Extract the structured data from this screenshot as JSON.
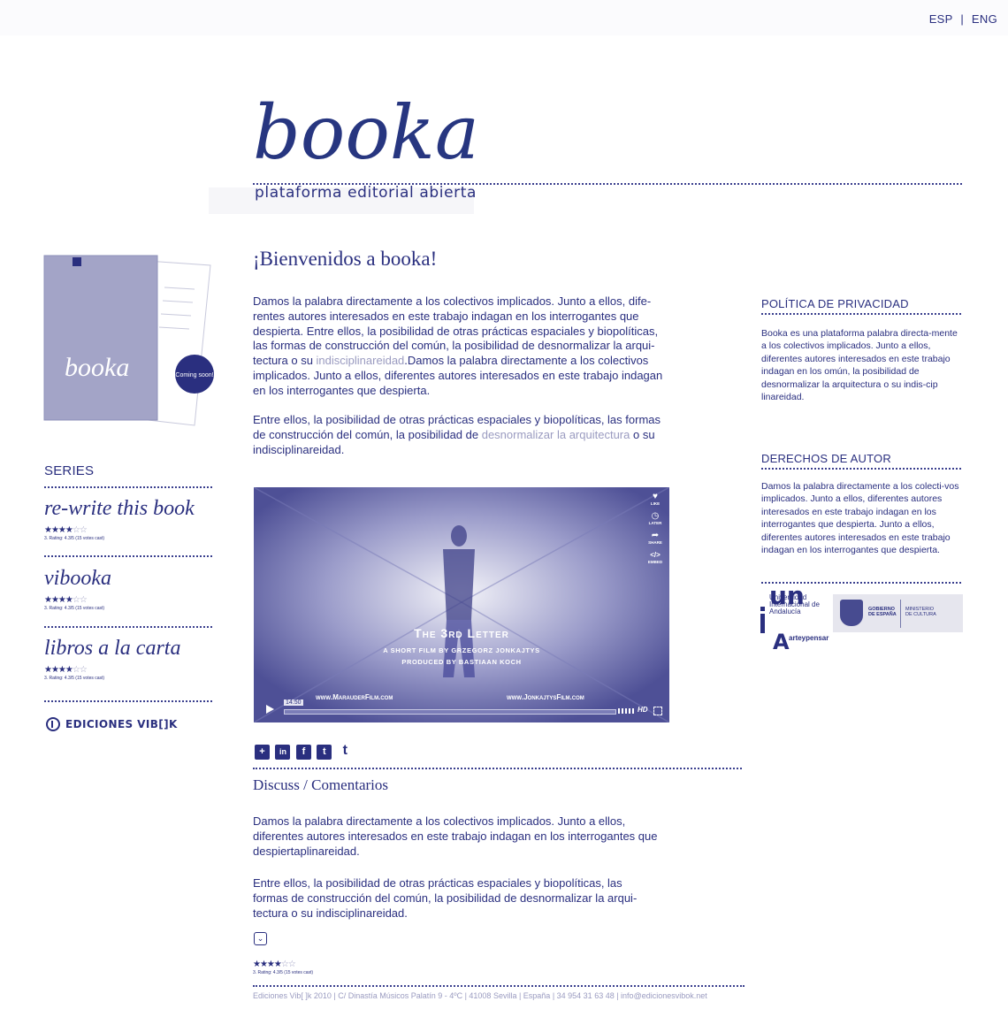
{
  "header": {
    "lang_esp": "ESP",
    "lang_sep": "|",
    "lang_eng": "ENG",
    "logo": "booka",
    "tagline": "plataforma editorial abierta"
  },
  "sidebar": {
    "book_cover_title": "booka",
    "book_badge": "Coming soon!",
    "series_heading": "SERIES",
    "series": [
      {
        "title": "re-write this book",
        "rating_text": "3. Rating: 4.3/5 (15 votes cast)",
        "stars": 3.5
      },
      {
        "title": "vibooka",
        "rating_text": "3. Rating: 4.3/5 (15 votes cast)",
        "stars": 3.5
      },
      {
        "title": "libros a la carta",
        "rating_text": "3. Rating: 4.3/5 (15 votes cast)",
        "stars": 3.5
      }
    ],
    "publisher_logo": "EDICIONES VIB[]K"
  },
  "main": {
    "welcome": "¡Bienvenidos a booka!",
    "intro_p1_a": "Damos la palabra directamente a los colectivos implicados. Junto a ellos, dife-rentes autores interesados en este trabajo indagan en los interrogantes que despierta. Entre ellos, la posibilidad de otras prácticas espaciales y biopolíticas, las formas de construcción del común, la posibilidad de desnormalizar la arqui-tectura o su ",
    "intro_p1_link": "indisciplinareidad",
    "intro_p1_b": ".Damos la palabra directamente a los colectivos implicados. Junto a ellos, diferentes autores interesados en este trabajo indagan en los interrogantes que despierta.",
    "intro_p2_a": "Entre ellos, la posibilidad de otras prácticas espaciales y biopolíticas, las formas de construcción del común, la posibilidad de ",
    "intro_p2_link": "desnormalizar la arquitectura",
    "intro_p2_b": " o su indisciplinareidad.",
    "video": {
      "title": "The 3rd Letter",
      "subtitle": "A SHORT FILM BY GRZEGORZ JONKAJTYS",
      "produced": "PRODUCED BY BASTIAAN KOCH",
      "url_left": "www.MarauderFilm.com",
      "url_right": "www.JonkajtysFilm.com",
      "time": "14:50",
      "side_buttons": [
        "LIKE",
        "LATER",
        "SHARE",
        "EMBED"
      ],
      "hd": "HD"
    },
    "share_icons": [
      "+",
      "in",
      "f",
      "t",
      "t"
    ],
    "discuss_title": "Discuss / Comentarios",
    "discuss_p1": "Damos la palabra directamente a los colectivos implicados. Junto a ellos, diferentes autores interesados en este trabajo indagan en los interrogantes que despiertaplinareidad.",
    "discuss_p2": "Entre ellos, la posibilidad de otras prácticas espaciales y biopolíticas, las formas de construcción del común, la posibilidad de desnormalizar la arqui-tectura o su indisciplinareidad.",
    "rating_text": "3. Rating: 4.3/5 (15 votes cast)",
    "footer": "Ediciones Vib[ ]k 2010 | C/ Dinastía Músicos Palatín 9 - 4ºC | 41008 Sevilla | España | 34 954 31 63 48 | info@edicionesvibok.net"
  },
  "right": {
    "privacy_title": "POLÍTICA DE PRIVACIDAD",
    "privacy_text": "Booka es una plataforma palabra directa-mente a los colectivos implicados. Junto a ellos, diferentes autores interesados en este trabajo indagan en los omún, la posibilidad de desnormalizar la arquitectura o su indis-cip linareidad.",
    "rights_title": "DERECHOS DE AUTOR",
    "rights_text": "Damos la palabra directamente a los colecti-vos implicados. Junto a ellos, diferentes autores interesados en este trabajo indagan en los interrogantes que despierta. Junto a ellos, diferentes autores interesados en este trabajo indagan en los interrogantes que despierta.",
    "unia_logo": "unia",
    "unia_text": "Universidad Internacional de Andalucía",
    "arte_text": "arteypensar",
    "gob_text": "GOBIERNO DE ESPAÑA",
    "min_text": "MINISTERIO DE CULTURA"
  },
  "colors": {
    "primary": "#2a2f7f",
    "muted": "#9a9bc0",
    "video_bg": "#5a5c9e"
  }
}
